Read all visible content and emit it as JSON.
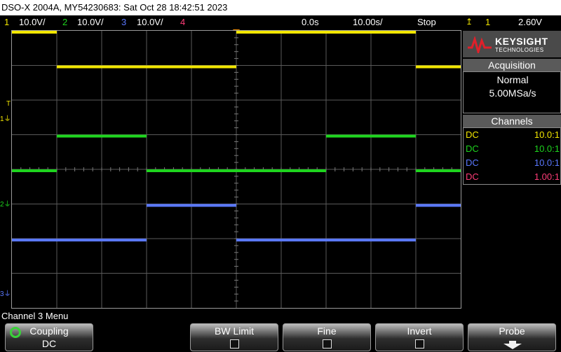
{
  "title_bar": "DSO-X 2004A, MY54230683: Sat Oct 28 18:42:51 2023",
  "channels_status": [
    {
      "num": "1",
      "scale": "10.0V/",
      "color": "#f2e600"
    },
    {
      "num": "2",
      "scale": "10.0V/",
      "color": "#1ed41e"
    },
    {
      "num": "3",
      "scale": "10.0V/",
      "color": "#5a78ff"
    },
    {
      "num": "4",
      "scale": "",
      "color": "#ff3c78"
    }
  ],
  "time_delay": "0.0s",
  "time_scale": "10.00s/",
  "run_state": "Stop",
  "trigger": {
    "icon": "rising-edge-icon",
    "channel": "1",
    "level": "2.60V"
  },
  "brand": {
    "name": "KEYSIGHT",
    "sub": "TECHNOLOGIES",
    "color": "#e0202a"
  },
  "acquisition": {
    "header": "Acquisition",
    "mode": "Normal",
    "rate": "5.00MSa/s"
  },
  "channels_panel": {
    "header": "Channels",
    "rows": [
      {
        "coupling": "DC",
        "ratio": "10.0:1",
        "color": "#f2e600"
      },
      {
        "coupling": "DC",
        "ratio": "10.0:1",
        "color": "#1ed41e"
      },
      {
        "coupling": "DC",
        "ratio": "10.0:1",
        "color": "#5a78ff"
      },
      {
        "coupling": "DC",
        "ratio": "1.00:1",
        "color": "#ff3c78"
      }
    ]
  },
  "markers": {
    "trigger_level": "T",
    "ch1": "1",
    "ch2": "2",
    "ch3": "3"
  },
  "menu_title": "Channel 3 Menu",
  "softkeys": {
    "coupling": {
      "label": "Coupling",
      "value": "DC"
    },
    "bw_limit": {
      "label": "BW Limit"
    },
    "fine": {
      "label": "Fine"
    },
    "invert": {
      "label": "Invert"
    },
    "probe": {
      "label": "Probe"
    }
  },
  "waveform_levels": {
    "ch1": {
      "high_div": 2.0,
      "low_div": 1.0
    },
    "ch2": {
      "high_div": 1.0,
      "low_div": 0.0
    },
    "ch3": {
      "high_div": 1.0,
      "low_div": 0.0
    }
  },
  "waveform_transitions_div": [
    1,
    3,
    5,
    7,
    9
  ],
  "colors": {
    "grid": "#5a5a5a",
    "frame": "#9a9a9a",
    "trigger_marker": "#f08c00"
  }
}
